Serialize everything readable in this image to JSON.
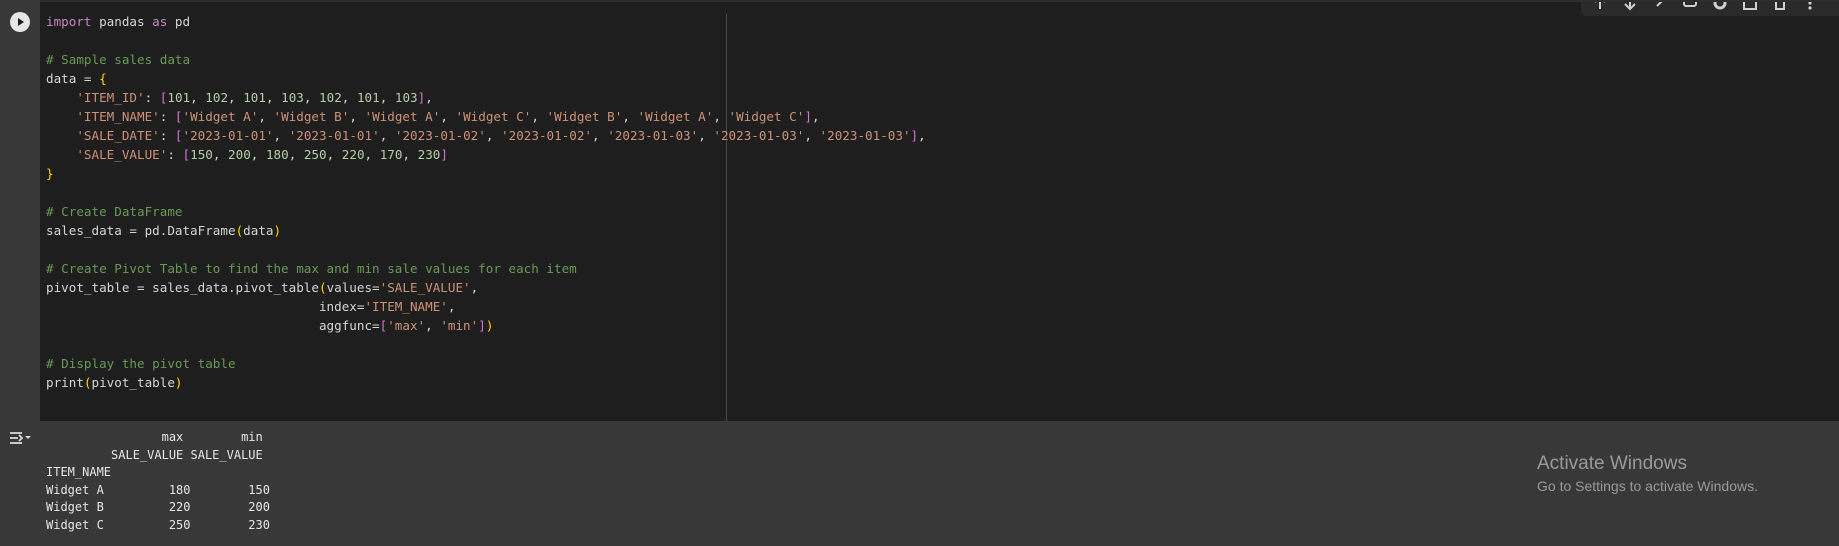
{
  "code_cell": {
    "run_button": "run-cell",
    "lines": [
      [
        {
          "t": "import",
          "c": "kw"
        },
        {
          "t": " pandas "
        },
        {
          "t": "as",
          "c": "kw"
        },
        {
          "t": " pd"
        }
      ],
      [],
      [
        {
          "t": "# Sample sales data",
          "c": "cm"
        }
      ],
      [
        {
          "t": "data = "
        },
        {
          "t": "{",
          "c": "b1"
        }
      ],
      [
        {
          "t": "    "
        },
        {
          "t": "'ITEM_ID'",
          "c": "st"
        },
        {
          "t": ": "
        },
        {
          "t": "[",
          "c": "b2"
        },
        {
          "t": "101",
          "c": "nm"
        },
        {
          "t": ", "
        },
        {
          "t": "102",
          "c": "nm"
        },
        {
          "t": ", "
        },
        {
          "t": "101",
          "c": "nm"
        },
        {
          "t": ", "
        },
        {
          "t": "103",
          "c": "nm"
        },
        {
          "t": ", "
        },
        {
          "t": "102",
          "c": "nm"
        },
        {
          "t": ", "
        },
        {
          "t": "101",
          "c": "nm"
        },
        {
          "t": ", "
        },
        {
          "t": "103",
          "c": "nm"
        },
        {
          "t": "]",
          "c": "b2"
        },
        {
          "t": ","
        }
      ],
      [
        {
          "t": "    "
        },
        {
          "t": "'ITEM_NAME'",
          "c": "st"
        },
        {
          "t": ": "
        },
        {
          "t": "[",
          "c": "b2"
        },
        {
          "t": "'Widget A'",
          "c": "st"
        },
        {
          "t": ", "
        },
        {
          "t": "'Widget B'",
          "c": "st"
        },
        {
          "t": ", "
        },
        {
          "t": "'Widget A'",
          "c": "st"
        },
        {
          "t": ", "
        },
        {
          "t": "'Widget C'",
          "c": "st"
        },
        {
          "t": ", "
        },
        {
          "t": "'Widget B'",
          "c": "st"
        },
        {
          "t": ", "
        },
        {
          "t": "'Widget A'",
          "c": "st"
        },
        {
          "t": ", "
        },
        {
          "t": "'Widget C'",
          "c": "st"
        },
        {
          "t": "]",
          "c": "b2"
        },
        {
          "t": ","
        }
      ],
      [
        {
          "t": "    "
        },
        {
          "t": "'SALE_DATE'",
          "c": "st"
        },
        {
          "t": ": "
        },
        {
          "t": "[",
          "c": "b2"
        },
        {
          "t": "'2023-01-01'",
          "c": "st"
        },
        {
          "t": ", "
        },
        {
          "t": "'2023-01-01'",
          "c": "st"
        },
        {
          "t": ", "
        },
        {
          "t": "'2023-01-02'",
          "c": "st"
        },
        {
          "t": ", "
        },
        {
          "t": "'2023-01-02'",
          "c": "st"
        },
        {
          "t": ", "
        },
        {
          "t": "'2023-01-03'",
          "c": "st"
        },
        {
          "t": ", "
        },
        {
          "t": "'2023-01-03'",
          "c": "st"
        },
        {
          "t": ", "
        },
        {
          "t": "'2023-01-03'",
          "c": "st"
        },
        {
          "t": "]",
          "c": "b2"
        },
        {
          "t": ","
        }
      ],
      [
        {
          "t": "    "
        },
        {
          "t": "'SALE_VALUE'",
          "c": "st"
        },
        {
          "t": ": "
        },
        {
          "t": "[",
          "c": "b2"
        },
        {
          "t": "150",
          "c": "nm"
        },
        {
          "t": ", "
        },
        {
          "t": "200",
          "c": "nm"
        },
        {
          "t": ", "
        },
        {
          "t": "180",
          "c": "nm"
        },
        {
          "t": ", "
        },
        {
          "t": "250",
          "c": "nm"
        },
        {
          "t": ", "
        },
        {
          "t": "220",
          "c": "nm"
        },
        {
          "t": ", "
        },
        {
          "t": "170",
          "c": "nm"
        },
        {
          "t": ", "
        },
        {
          "t": "230",
          "c": "nm"
        },
        {
          "t": "]",
          "c": "b2"
        }
      ],
      [
        {
          "t": "}",
          "c": "b1"
        }
      ],
      [],
      [
        {
          "t": "# Create DataFrame",
          "c": "cm"
        }
      ],
      [
        {
          "t": "sales_data = pd.DataFrame"
        },
        {
          "t": "(",
          "c": "b1"
        },
        {
          "t": "data"
        },
        {
          "t": ")",
          "c": "b1"
        }
      ],
      [],
      [
        {
          "t": "# Create Pivot Table to find the max and min sale values for each item",
          "c": "cm"
        }
      ],
      [
        {
          "t": "pivot_table = sales_data.pivot_table"
        },
        {
          "t": "(",
          "c": "b1"
        },
        {
          "t": "values="
        },
        {
          "t": "'SALE_VALUE'",
          "c": "st"
        },
        {
          "t": ","
        }
      ],
      [
        {
          "t": "                                    index="
        },
        {
          "t": "'ITEM_NAME'",
          "c": "st"
        },
        {
          "t": ","
        }
      ],
      [
        {
          "t": "                                    aggfunc="
        },
        {
          "t": "[",
          "c": "b2"
        },
        {
          "t": "'max'",
          "c": "st"
        },
        {
          "t": ", "
        },
        {
          "t": "'min'",
          "c": "st"
        },
        {
          "t": "]",
          "c": "b2"
        },
        {
          "t": ")",
          "c": "b1"
        }
      ],
      [],
      [
        {
          "t": "# Display the pivot table",
          "c": "cm"
        }
      ],
      [
        {
          "t": "print"
        },
        {
          "t": "(",
          "c": "b1"
        },
        {
          "t": "pivot_table"
        },
        {
          "t": ")",
          "c": "b1"
        }
      ]
    ]
  },
  "toolbar": {
    "icons": [
      "arrow-up-icon",
      "arrow-down-icon",
      "link-icon",
      "comment-icon",
      "gear-icon",
      "mirror-cell-icon",
      "delete-icon",
      "more-icon"
    ]
  },
  "output": {
    "icon": "output-actions-icon",
    "lines": [
      "                max        min",
      "         SALE_VALUE SALE_VALUE",
      "ITEM_NAME",
      "Widget A         180        150",
      "Widget B         220        200",
      "Widget C         250        230"
    ]
  },
  "watermark": {
    "title": "Activate Windows",
    "subtitle": "Go to Settings to activate Windows."
  },
  "colors": {
    "editor_bg": "#1e1e1e",
    "panel_bg": "#383838",
    "keyword": "#c586c0",
    "comment": "#6a9955",
    "string": "#ce9178",
    "number": "#b5cea8",
    "bracket_1": "#ffd700",
    "bracket_2": "#da70d6"
  }
}
